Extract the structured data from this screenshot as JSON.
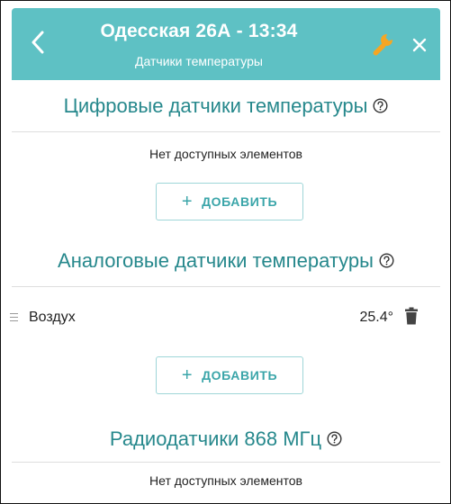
{
  "header": {
    "title": "Одесская 26А - 13:34",
    "subtitle": "Датчики температуры",
    "back_icon": "chevron-left-icon",
    "settings_icon": "wrench-icon",
    "close_icon": "close-icon",
    "background": "#5ec1c4",
    "wrench_color": "#f5a623"
  },
  "sections": {
    "digital": {
      "title": "Цифровые датчики температуры",
      "empty_text": "Нет доступных элементов",
      "add_label": "ДОБАВИТЬ"
    },
    "analog": {
      "title": "Аналоговые датчики температуры",
      "add_label": "ДОБАВИТЬ",
      "items": [
        {
          "name": "Воздух",
          "value": "25.4°"
        }
      ]
    },
    "radio": {
      "title": "Радиодатчики 868 МГц",
      "empty_text": "Нет доступных элементов"
    }
  },
  "colors": {
    "section_title": "#26888c",
    "accent": "#3aa5a9",
    "button_border": "#9fd6d8"
  },
  "icons": {
    "help": "help-circle-icon",
    "plus": "plus-icon",
    "drag": "drag-handle-icon",
    "delete": "trash-icon"
  }
}
